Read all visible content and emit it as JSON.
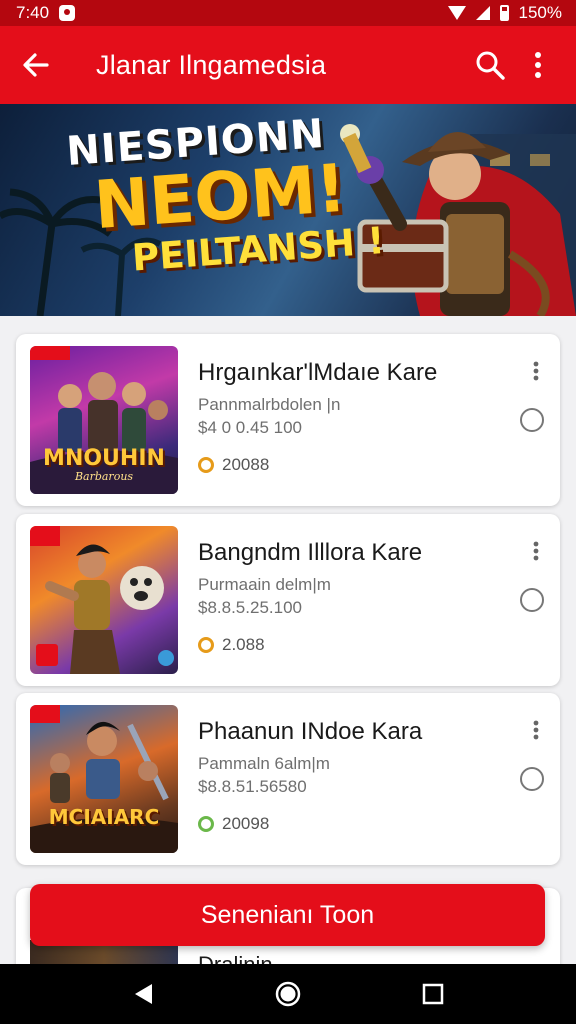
{
  "status_bar": {
    "time": "7:40",
    "battery": "150%"
  },
  "app_bar": {
    "title": "Jlanar Ilngamedsia"
  },
  "banner": {
    "line1": "NIESPIONN",
    "line2": "NEOM!",
    "line3": "PEILTANSH !"
  },
  "games": [
    {
      "title": "Hrgaınkar'lMdaıe Kare",
      "subtitle": "Pannmalrbdolen |n",
      "price": "$4 0 0.45 100",
      "coins": "20088",
      "thumb_caption": "MNOUHIN",
      "thumb_sub": "Barbarous",
      "coin_color": "#e69b1a"
    },
    {
      "title": "Bangndm Illlora Kare",
      "subtitle": "Purmaain delm|m",
      "price": "$8.8.5.25.100",
      "coins": "2.088",
      "thumb_caption": "",
      "thumb_sub": "",
      "coin_color": "#e69b1a"
    },
    {
      "title": "Phaanun INdoe Kara",
      "subtitle": "Pammaln 6alm|m",
      "price": "$8.8.51.56580",
      "coins": "20098",
      "thumb_caption": "MCIAIARC",
      "thumb_sub": "",
      "coin_color": "#6bb84a"
    }
  ],
  "peek_card": {
    "title": "Dralinin"
  },
  "cta": {
    "label": "Senenianı Toon"
  }
}
